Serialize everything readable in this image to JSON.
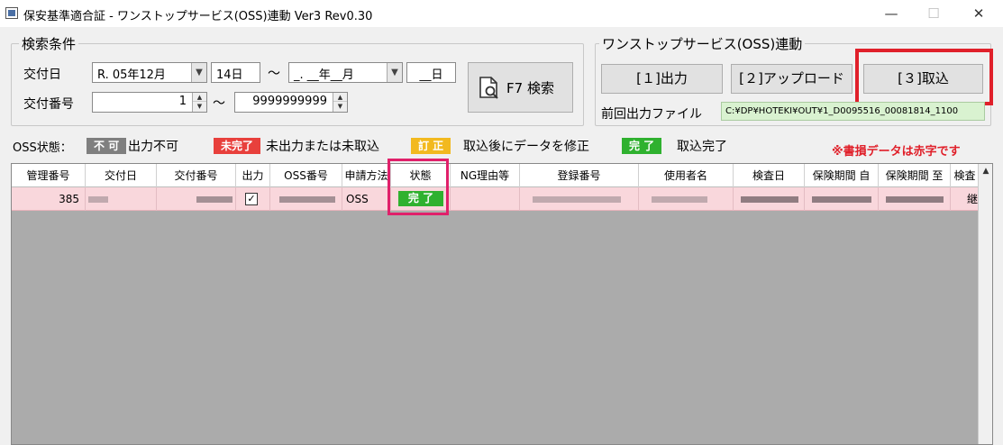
{
  "window": {
    "title": "保安基準適合証 - ワンストップサービス(OSS)連動 Ver3 Rev0.30",
    "minimize": "—",
    "maximize": "☐",
    "close": "✕"
  },
  "search": {
    "group_title": "検索条件",
    "issue_date_label": "交付日",
    "date_from_era": "R. 05年12月",
    "date_from_day": "14日",
    "tilde": "〜",
    "date_to_era": "_. __年__月",
    "date_to_day": "__日",
    "issue_no_label": "交付番号",
    "issue_no_from": "1",
    "issue_no_to": "9999999999",
    "search_button": "F7 検索"
  },
  "oss": {
    "group_title": "ワンストップサービス(OSS)連動",
    "btn_output": "[１]出力",
    "btn_upload": "[２]アップロード",
    "btn_import": "[３]取込",
    "last_file_label": "前回出力ファイル",
    "last_file_value": "C:¥DP¥HOTEKI¥OUT¥1_D0095516_00081814_1100"
  },
  "legend": {
    "label": "OSS状態：",
    "items": [
      {
        "badge": "不 可",
        "text": "出力不可",
        "color": "#7f7f7f"
      },
      {
        "badge": "未完了",
        "text": "未出力または未取込",
        "color": "#e8403c"
      },
      {
        "badge": "訂 正",
        "text": "取込後にデータを修正",
        "color": "#f2b91f"
      },
      {
        "badge": "完 了",
        "text": "取込完了",
        "color": "#2fb12f"
      }
    ],
    "note": "※書損データは赤字です"
  },
  "grid": {
    "columns": [
      "管理番号",
      "交付日",
      "交付番号",
      "出力",
      "OSS番号",
      "申請方法",
      "状態",
      "NG理由等",
      "登録番号",
      "使用者名",
      "検査日",
      "保険期間 自",
      "保険期間 至",
      "検査"
    ],
    "row": {
      "mgmt_no": "385",
      "output_check": "✓",
      "method": "OSS",
      "status": "完 了",
      "last_cell": "継"
    }
  }
}
